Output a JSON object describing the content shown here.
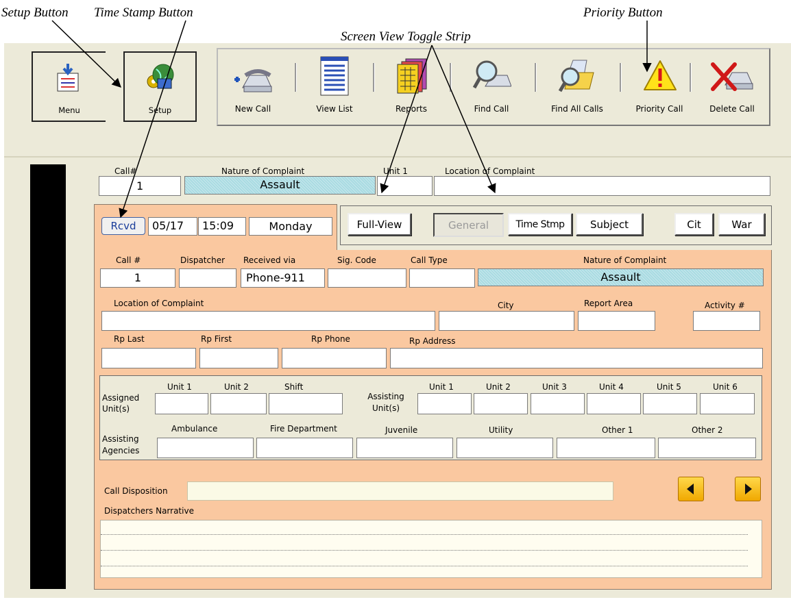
{
  "callouts": {
    "setup": "Setup Button",
    "timestamp": "Time Stamp Button",
    "screen_view": "Screen View Toggle Strip",
    "priority": "Priority Button"
  },
  "tiles": {
    "menu": "Menu",
    "setup": "Setup"
  },
  "toolbar": [
    {
      "label": "New Call",
      "icon": "phone-plus-icon"
    },
    {
      "label": "View List",
      "icon": "list-icon"
    },
    {
      "label": "Reports",
      "icon": "reports-icon"
    },
    {
      "label": "Find Call",
      "icon": "find-call-icon"
    },
    {
      "label": "Find All Calls",
      "icon": "find-all-calls-icon"
    },
    {
      "label": "Priority Call",
      "icon": "warning-icon"
    },
    {
      "label": "Delete Call",
      "icon": "delete-call-icon"
    }
  ],
  "header": {
    "call_label": "Call#",
    "call_value": "1",
    "nature_label": "Nature of Complaint",
    "nature_value": "Assault",
    "unit_label": "Unit 1",
    "unit_value": "",
    "location_label": "Location of Complaint",
    "location_value": ""
  },
  "stamp": {
    "rcvd": "Rcvd",
    "date": "05/17",
    "time": "15:09",
    "day": "Monday"
  },
  "view_strip": {
    "full": "Full-View",
    "general": "General",
    "timestmp": "Time Stmp",
    "subject": "Subject",
    "cit": "Cit",
    "war": "War"
  },
  "form": {
    "call_label": "Call #",
    "call_value": "1",
    "dispatcher_label": "Dispatcher",
    "dispatcher_value": "",
    "received_label": "Received via",
    "received_value": "Phone-911",
    "sigcode_label": "Sig. Code",
    "calltype_label": "Call Type",
    "nature_label": "Nature of Complaint",
    "nature_value": "Assault",
    "location_label": "Location of Complaint",
    "city_label": "City",
    "report_area_label": "Report Area",
    "activity_label": "Activity #",
    "rp_last_label": "Rp Last",
    "rp_first_label": "Rp First",
    "rp_phone_label": "Rp Phone",
    "rp_address_label": "Rp Address"
  },
  "units": {
    "assigned_label": "Assigned Unit(s)",
    "assigned_cols": [
      "Unit 1",
      "Unit 2",
      "Shift"
    ],
    "assisting_label": "Assisting Unit(s)",
    "assisting_cols": [
      "Unit 1",
      "Unit 2",
      "Unit 3",
      "Unit 4",
      "Unit 5",
      "Unit 6"
    ],
    "agencies_label": "Assisting Agencies",
    "agency_cols": [
      "Ambulance",
      "Fire Department",
      "Juvenile",
      "Utility",
      "Other 1",
      "Other 2"
    ]
  },
  "disposition_label": "Call Disposition",
  "narrative_label": "Dispatchers Narrative"
}
